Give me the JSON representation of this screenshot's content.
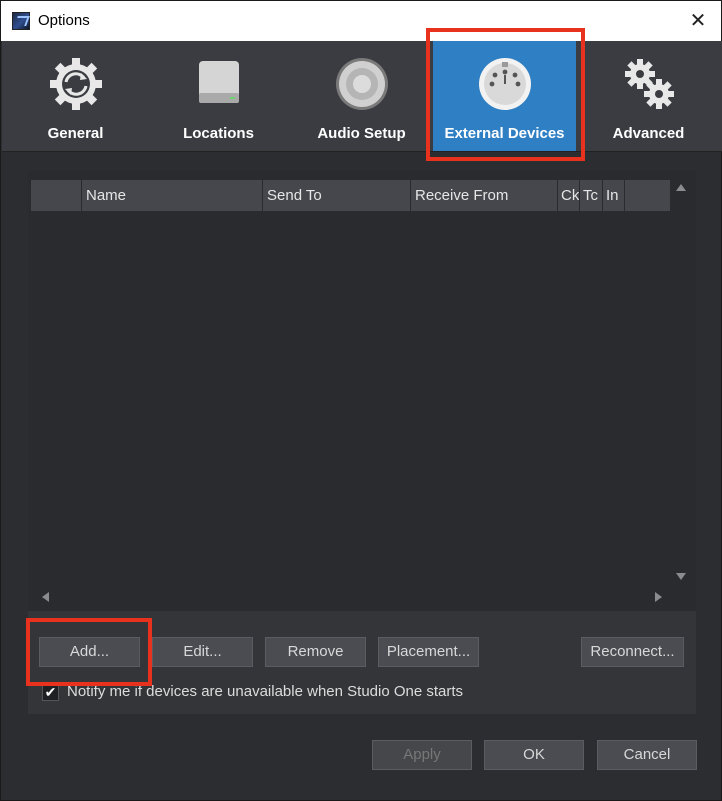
{
  "window": {
    "title": "Options",
    "close_glyph": "✕"
  },
  "tabs": [
    {
      "label": "General",
      "icon": "sync-gear-icon"
    },
    {
      "label": "Locations",
      "icon": "hard-drive-icon"
    },
    {
      "label": "Audio Setup",
      "icon": "speaker-icon"
    },
    {
      "label": "External Devices",
      "icon": "midi-connector-icon",
      "active": true
    },
    {
      "label": "Advanced",
      "icon": "gears-icon"
    }
  ],
  "table": {
    "columns": [
      "",
      "Name",
      "Send To",
      "Receive From",
      "Ck",
      "Tc",
      "In",
      ""
    ],
    "rows": []
  },
  "buttons": {
    "add": "Add...",
    "edit": "Edit...",
    "remove": "Remove",
    "placement": "Placement...",
    "reconnect": "Reconnect..."
  },
  "notify": {
    "checked": true,
    "check_glyph": "✔",
    "label": "Notify me if devices are unavailable when Studio One starts"
  },
  "footer": {
    "apply": "Apply",
    "ok": "OK",
    "cancel": "Cancel"
  },
  "colors": {
    "accent": "#2e7fc4",
    "highlight": "#e8321e",
    "background": "#2b2d31"
  }
}
